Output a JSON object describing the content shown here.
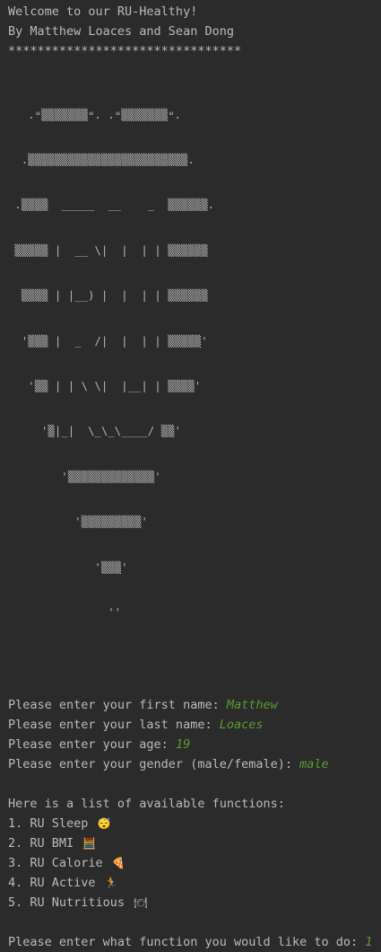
{
  "header": {
    "welcome": "Welcome to our RU-Healthy!",
    "authors": "By Matthew Loaces and Sean Dong",
    "separator": "********************************"
  },
  "ascii_art": [
    "   .ᵚ▒▒▒▒▒▒▒ᵚ. .ᵚ▒▒▒▒▒▒▒ᵚ.",
    "  .▒▒▒▒▒▒▒▒▒▒▒▒▒▒▒▒▒▒▒▒▒▒▒▒.",
    " .▒▒▒▒  _____  __    _  ▒▒▒▒▒▒.",
    " ▒▒▒▒▒ |  __ \\|  |  | | ▒▒▒▒▒▒",
    "  ▒▒▒▒ | |__) |  |  | | ▒▒▒▒▒▒",
    "  '▒▒▒ |  _  /|  |  | | ▒▒▒▒▒'",
    "   '▒▒ | | \\ \\|  |__| | ▒▒▒▒'",
    "     '▒|_|  \\_\\_\\____/ ▒▒'",
    "        '▒▒▒▒▒▒▒▒▒▒▒▒▒'",
    "          '▒▒▒▒▒▒▒▒▒'",
    "             '▒▒▒'",
    "               ''"
  ],
  "prompts": [
    {
      "label": "Please enter your first name: ",
      "value": "Matthew"
    },
    {
      "label": "Please enter your last name: ",
      "value": "Loaces"
    },
    {
      "label": "Please enter your age: ",
      "value": "19"
    },
    {
      "label": "Please enter your gender (male/female): ",
      "value": "male"
    }
  ],
  "functions": {
    "heading": "Here is a list of available functions:",
    "items": [
      {
        "label": "1. RU Sleep",
        "icon": "😴",
        "icon_name": "sleeping-face-icon"
      },
      {
        "label": "2. RU BMI",
        "icon": "🧮",
        "icon_name": "abacus-icon"
      },
      {
        "label": "3. RU Calorie",
        "icon": "🍕",
        "icon_name": "pizza-icon"
      },
      {
        "label": "4. RU Active",
        "icon": "🏃",
        "icon_name": "running-person-icon"
      },
      {
        "label": "5. RU Nutritious",
        "icon": "🍽",
        "icon_name": "plate-icon"
      }
    ]
  },
  "final_prompt": {
    "label": "Please enter what function you would like to do: ",
    "value": "1"
  },
  "colors": {
    "background": "#2b2b2b",
    "text": "#bbbbbb",
    "user_input": "#5d9b2f"
  }
}
